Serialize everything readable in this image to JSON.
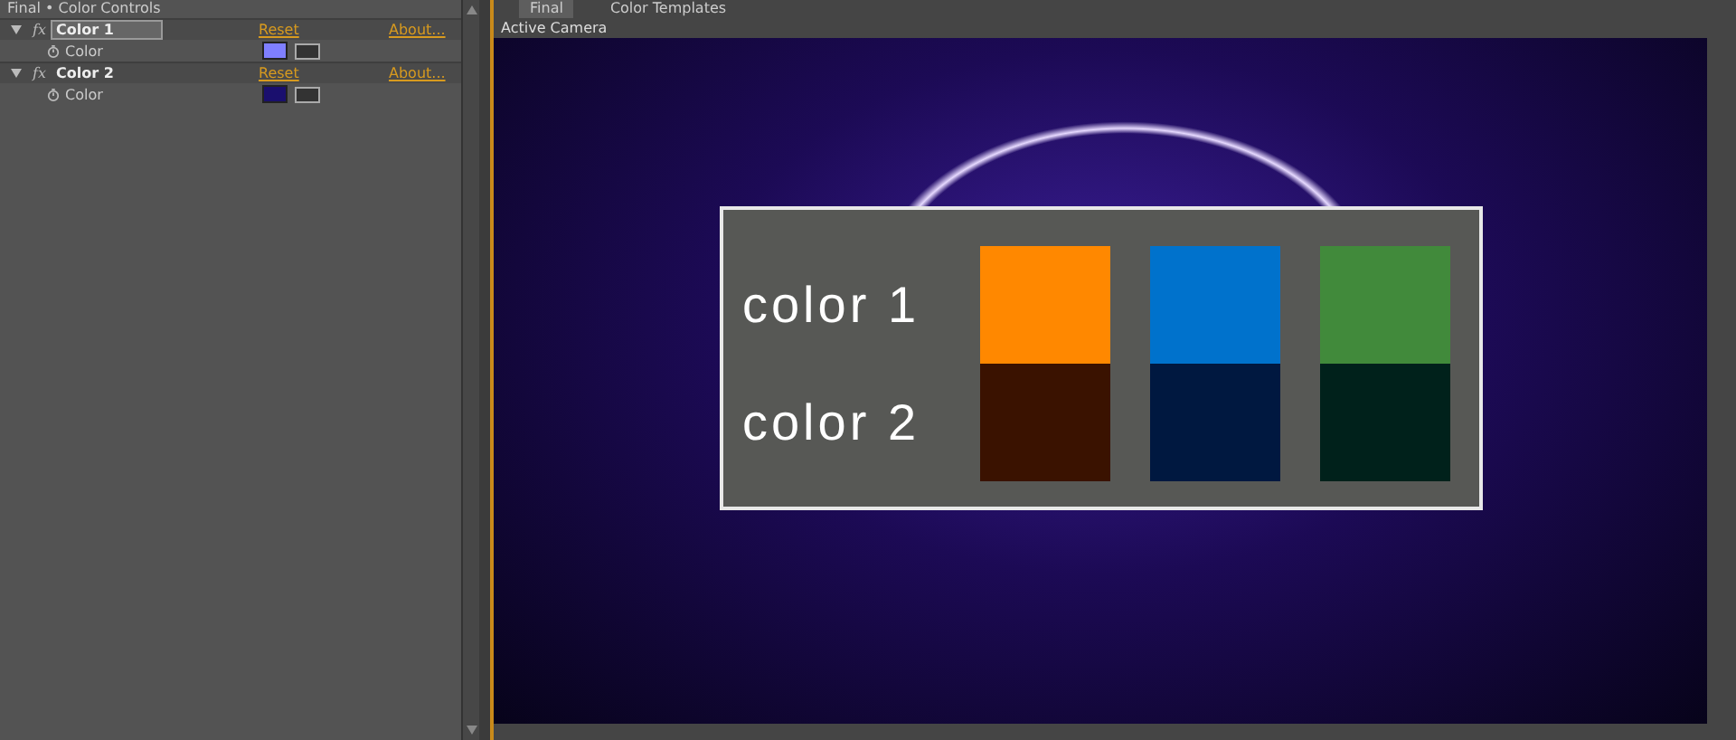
{
  "effect_controls": {
    "title": "Final • Color Controls",
    "effects": [
      {
        "name": "Color 1",
        "selected": true,
        "expanded": true,
        "fx": "fx",
        "reset": "Reset",
        "about": "About...",
        "property": {
          "label": "Color",
          "color": "#7f7fff"
        }
      },
      {
        "name": "Color 2",
        "selected": false,
        "expanded": true,
        "fx": "fx",
        "reset": "Reset",
        "about": "About...",
        "property": {
          "label": "Color",
          "color": "#1a0f6e"
        }
      }
    ]
  },
  "viewer": {
    "tabs": [
      {
        "label": "Final",
        "selected": true
      },
      {
        "label": "Color Templates",
        "selected": false
      }
    ],
    "camera": "Active Camera",
    "card": {
      "rows": [
        {
          "label": "color 1",
          "swatches": [
            {
              "color": "#ff8800"
            },
            {
              "color": "#0072cc"
            },
            {
              "color": "#418a3b"
            }
          ]
        },
        {
          "label": "color 2",
          "swatches": [
            {
              "color": "#3a1200"
            },
            {
              "color": "#001840"
            },
            {
              "color": "#00211b"
            }
          ]
        }
      ]
    }
  }
}
